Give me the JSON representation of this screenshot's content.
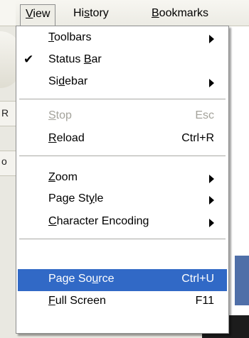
{
  "menubar": {
    "items": [
      {
        "label": "View",
        "mnemonic_index": 0
      },
      {
        "label": "History",
        "mnemonic_index": 2
      },
      {
        "label": "Bookmarks",
        "mnemonic_index": 0
      }
    ]
  },
  "background": {
    "left_letters": [
      "R",
      "o"
    ]
  },
  "menu": {
    "items": [
      {
        "pre": "",
        "mn": "T",
        "post": "oolbars",
        "accel": "",
        "submenu": true,
        "checked": false,
        "disabled": false,
        "highlighted": false
      },
      {
        "pre": "Status ",
        "mn": "B",
        "post": "ar",
        "accel": "",
        "submenu": false,
        "checked": true,
        "disabled": false,
        "highlighted": false
      },
      {
        "pre": "Si",
        "mn": "d",
        "post": "ebar",
        "accel": "",
        "submenu": true,
        "checked": false,
        "disabled": false,
        "highlighted": false
      },
      {
        "pre": "",
        "mn": "S",
        "post": "top",
        "accel": "Esc",
        "submenu": false,
        "checked": false,
        "disabled": true,
        "highlighted": false
      },
      {
        "pre": "",
        "mn": "R",
        "post": "eload",
        "accel": "Ctrl+R",
        "submenu": false,
        "checked": false,
        "disabled": false,
        "highlighted": false
      },
      {
        "pre": "",
        "mn": "Z",
        "post": "oom",
        "accel": "",
        "submenu": true,
        "checked": false,
        "disabled": false,
        "highlighted": false
      },
      {
        "pre": "Page St",
        "mn": "y",
        "post": "le",
        "accel": "",
        "submenu": true,
        "checked": false,
        "disabled": false,
        "highlighted": false
      },
      {
        "pre": "",
        "mn": "C",
        "post": "haracter Encoding",
        "accel": "",
        "submenu": true,
        "checked": false,
        "disabled": false,
        "highlighted": false
      },
      {
        "pre": "Page So",
        "mn": "u",
        "post": "rce",
        "accel": "Ctrl+U",
        "submenu": false,
        "checked": false,
        "disabled": false,
        "highlighted": true
      },
      {
        "pre": "",
        "mn": "F",
        "post": "ull Screen",
        "accel": "F11",
        "submenu": false,
        "checked": false,
        "disabled": false,
        "highlighted": false
      }
    ],
    "check_glyph": "✔"
  },
  "colors": {
    "highlight": "#3169c6",
    "disabled_text": "#a4a39b"
  }
}
